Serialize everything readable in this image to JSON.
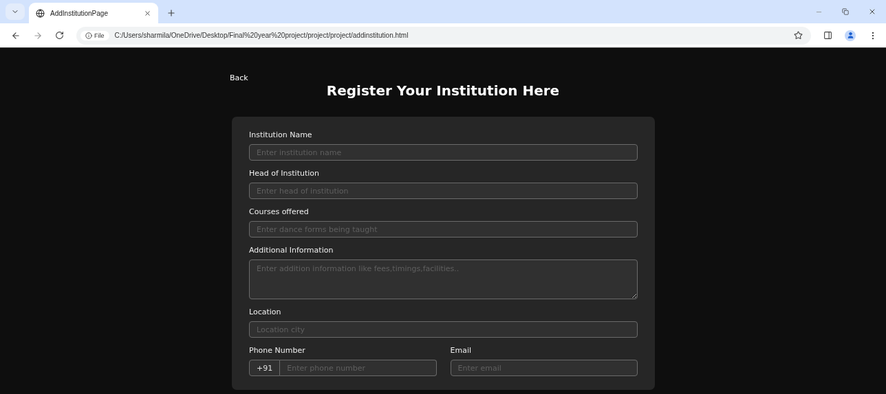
{
  "browser": {
    "tab": {
      "title": "AddInstitutionPage",
      "selected": true
    },
    "url_chip": "File",
    "url": "C:/Users/sharmila/OneDrive/Desktop/Final%20year%20project/project/project/addinstitution.html"
  },
  "page": {
    "back": "Back",
    "title": "Register Your Institution Here",
    "fields": [
      {
        "kind": "input",
        "label": "Institution Name",
        "placeholder": "Enter institution name"
      },
      {
        "kind": "input",
        "label": "Head of Institution",
        "placeholder": "Enter head of institution"
      },
      {
        "kind": "input",
        "label": "Courses offered",
        "placeholder": "Enter dance forms being taught"
      },
      {
        "kind": "textarea",
        "label": "Additional Information",
        "placeholder": "Enter addition information like fees,timings,facilities.."
      },
      {
        "kind": "input",
        "label": "Location",
        "placeholder": "Location city"
      }
    ],
    "phone": {
      "label": "Phone Number",
      "prefix": "+91",
      "placeholder": "Enter phone number"
    },
    "email": {
      "label": "Email",
      "placeholder": "Enter email"
    }
  }
}
